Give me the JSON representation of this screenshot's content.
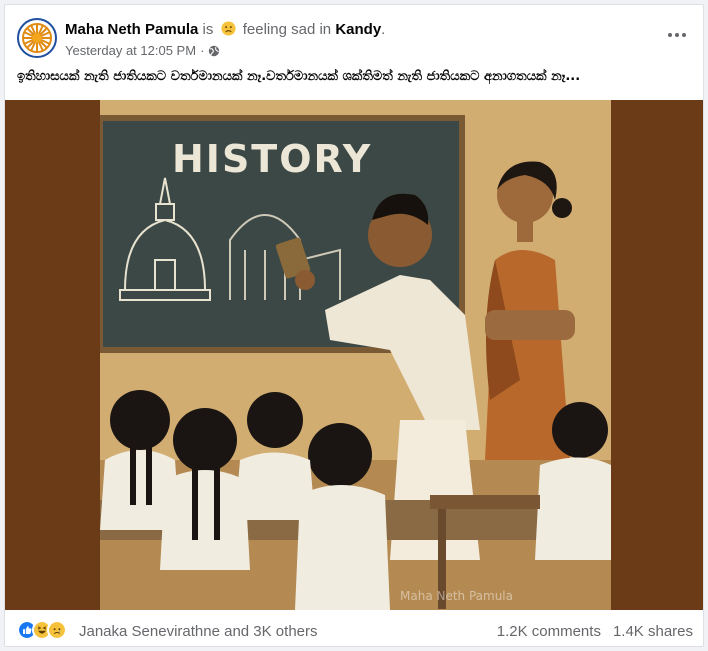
{
  "post": {
    "author": "Maha Neth Pamula",
    "status_is": "is",
    "feeling": "feeling sad",
    "in_word": "in",
    "location": "Kandy",
    "period": ".",
    "timestamp": "Yesterday at 12:05 PM",
    "separator": "·",
    "audience_icon": "globe-icon",
    "caption": "ඉතිහාසයක් නැති ජාතියකට වර්තමානයක් නෑ.වර්තමානයක්  ශක්තිමත් නැති ජාතියකට අනාගතයක් නෑ..."
  },
  "image": {
    "blackboard_title": "HISTORY",
    "watermark": "Maha Neth Pamula"
  },
  "footer": {
    "reaction_icons": [
      "like-icon",
      "haha-icon",
      "sad-icon"
    ],
    "reactors": "Janaka Senevirathne and 3K others",
    "comments": "1.2K comments",
    "shares": "1.4K shares"
  },
  "colors": {
    "accent": "#1877f2",
    "frame": "#6b3b17",
    "chalkboard": "#2f3a37",
    "saree": "#b9682b"
  }
}
